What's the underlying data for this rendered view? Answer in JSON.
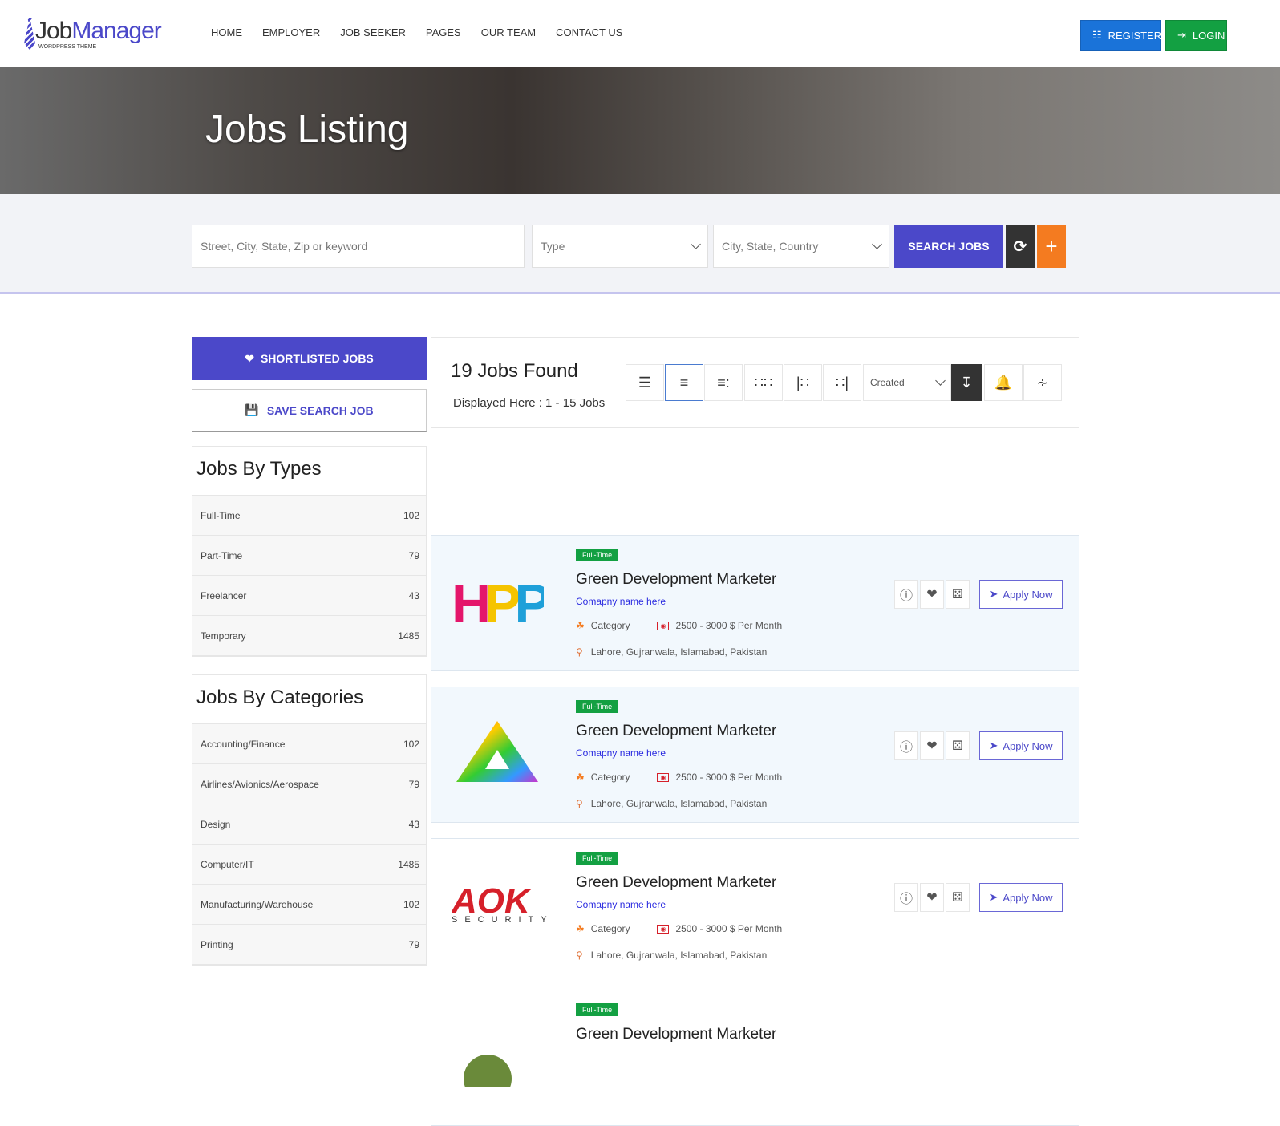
{
  "header": {
    "logo_job": "Job",
    "logo_manager": "Manager",
    "logo_sub": "WORDPRESS THEME",
    "nav": [
      "HOME",
      "EMPLOYER",
      "JOB SEEKER",
      "PAGES",
      "OUR TEAM",
      "CONTACT US"
    ],
    "register": "REGISTER",
    "login": "LOGIN"
  },
  "hero": {
    "title": "Jobs Listing"
  },
  "search": {
    "keyword_placeholder": "Street, City, State, Zip or keyword",
    "type_placeholder": "Type",
    "location_placeholder": "City, State, Country",
    "search_label": "SEARCH JOBS"
  },
  "sidebar": {
    "shortlisted": "SHORTLISTED JOBS",
    "save_search": "SAVE SEARCH JOB",
    "types_title": "Jobs By Types",
    "types": [
      {
        "label": "Full-Time",
        "count": "102"
      },
      {
        "label": "Part-Time",
        "count": "79"
      },
      {
        "label": "Freelancer",
        "count": "43"
      },
      {
        "label": "Temporary",
        "count": "1485"
      }
    ],
    "categories_title": "Jobs By Categories",
    "categories": [
      {
        "label": "Accounting/Finance",
        "count": "102"
      },
      {
        "label": "Airlines/Avionics/Aerospace",
        "count": "79"
      },
      {
        "label": "Design",
        "count": "43"
      },
      {
        "label": "Computer/IT",
        "count": "1485"
      },
      {
        "label": "Manufacturing/Warehouse",
        "count": "102"
      },
      {
        "label": "Printing",
        "count": "79"
      }
    ]
  },
  "results": {
    "count_text": "19 Jobs Found",
    "displayed_text": "Displayed Here : 1 - 15 Jobs",
    "sort_value": "Created"
  },
  "jobs": [
    {
      "type": "Full-Time",
      "title": "Green Development Marketer",
      "company": "Comapny name here",
      "category": "Category",
      "salary": "2500 - 3000 $ Per Month",
      "location": "Lahore, Gujranwala, Islamabad, Pakistan",
      "apply": "Apply Now",
      "logo": "HPPY"
    },
    {
      "type": "Full-Time",
      "title": "Green Development Marketer",
      "company": "Comapny name here",
      "category": "Category",
      "salary": "2500 - 3000 $ Per Month",
      "location": "Lahore, Gujranwala, Islamabad, Pakistan",
      "apply": "Apply Now",
      "logo": "triangle"
    },
    {
      "type": "Full-Time",
      "title": "Green Development Marketer",
      "company": "Comapny name here",
      "category": "Category",
      "salary": "2500 - 3000 $ Per Month",
      "location": "Lahore, Gujranwala, Islamabad, Pakistan",
      "apply": "Apply Now",
      "logo": "AOK",
      "logo_sub": "SECURITY"
    },
    {
      "type": "Full-Time",
      "title": "Green Development Marketer",
      "company": "",
      "category": "",
      "salary": "",
      "location": "",
      "apply": "",
      "logo": "circle"
    }
  ],
  "colors": {
    "primary": "#4b48c9",
    "login": "#13a042",
    "register": "#1a73d9",
    "dark": "#333333",
    "orange": "#f47b20"
  }
}
